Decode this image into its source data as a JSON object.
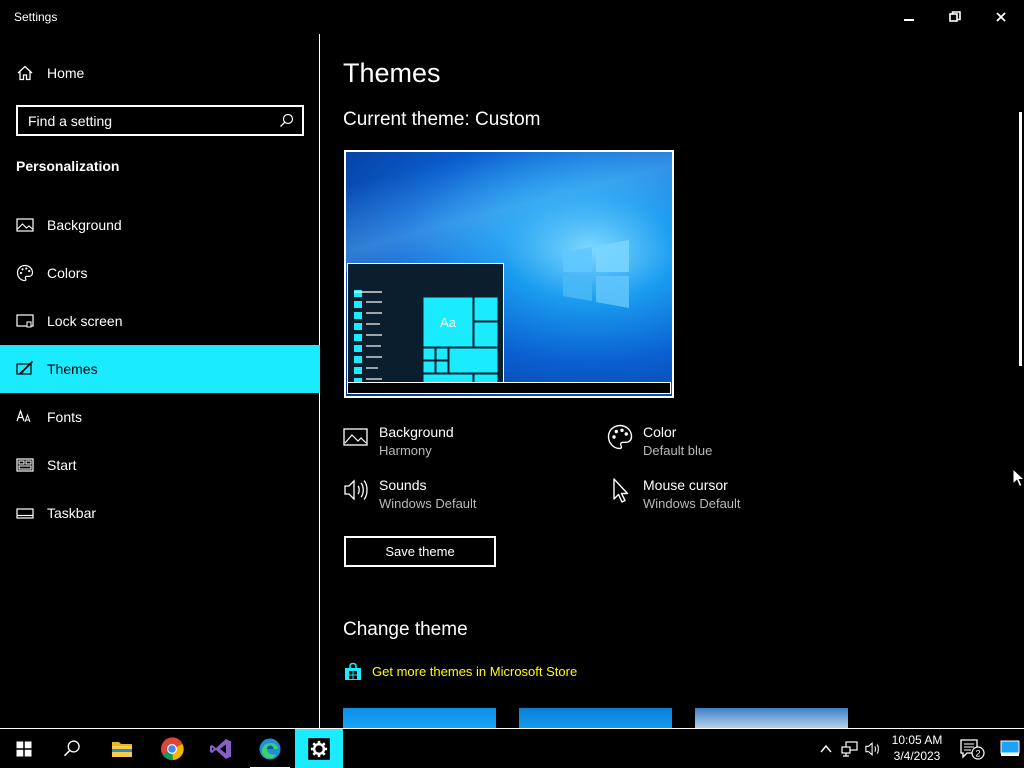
{
  "window": {
    "title": "Settings",
    "controls": {
      "minimize": "minimize",
      "restore": "restore",
      "close": "close"
    }
  },
  "sidebar": {
    "home_label": "Home",
    "search_placeholder": "Find a setting",
    "section": "Personalization",
    "items": [
      {
        "label": "Background",
        "icon": "picture-icon"
      },
      {
        "label": "Colors",
        "icon": "palette-icon"
      },
      {
        "label": "Lock screen",
        "icon": "lock-screen-icon"
      },
      {
        "label": "Themes",
        "icon": "themes-icon",
        "active": true
      },
      {
        "label": "Fonts",
        "icon": "fonts-icon"
      },
      {
        "label": "Start",
        "icon": "start-icon"
      },
      {
        "label": "Taskbar",
        "icon": "taskbar-icon"
      }
    ]
  },
  "main": {
    "title": "Themes",
    "current_theme": "Current theme: Custom",
    "preview_tile_text": "Aa",
    "properties": {
      "background": {
        "name": "Background",
        "value": "Harmony"
      },
      "color": {
        "name": "Color",
        "value": "Default blue"
      },
      "sounds": {
        "name": "Sounds",
        "value": "Windows Default"
      },
      "mouse_cursor": {
        "name": "Mouse cursor",
        "value": "Windows Default"
      }
    },
    "save_button": "Save theme",
    "change_theme_title": "Change theme",
    "store_link": "Get more themes in Microsoft Store"
  },
  "taskbar": {
    "apps": [
      "start-icon",
      "search-icon",
      "file-explorer-icon",
      "chrome-icon",
      "visual-studio-icon",
      "edge-icon",
      "settings-icon"
    ],
    "clock_time": "10:05 AM",
    "clock_date": "3/4/2023",
    "notification_count": "2"
  },
  "colors": {
    "accent": "#1aebff",
    "link": "#ffff00",
    "secondary_text": "#b8b8b8"
  }
}
